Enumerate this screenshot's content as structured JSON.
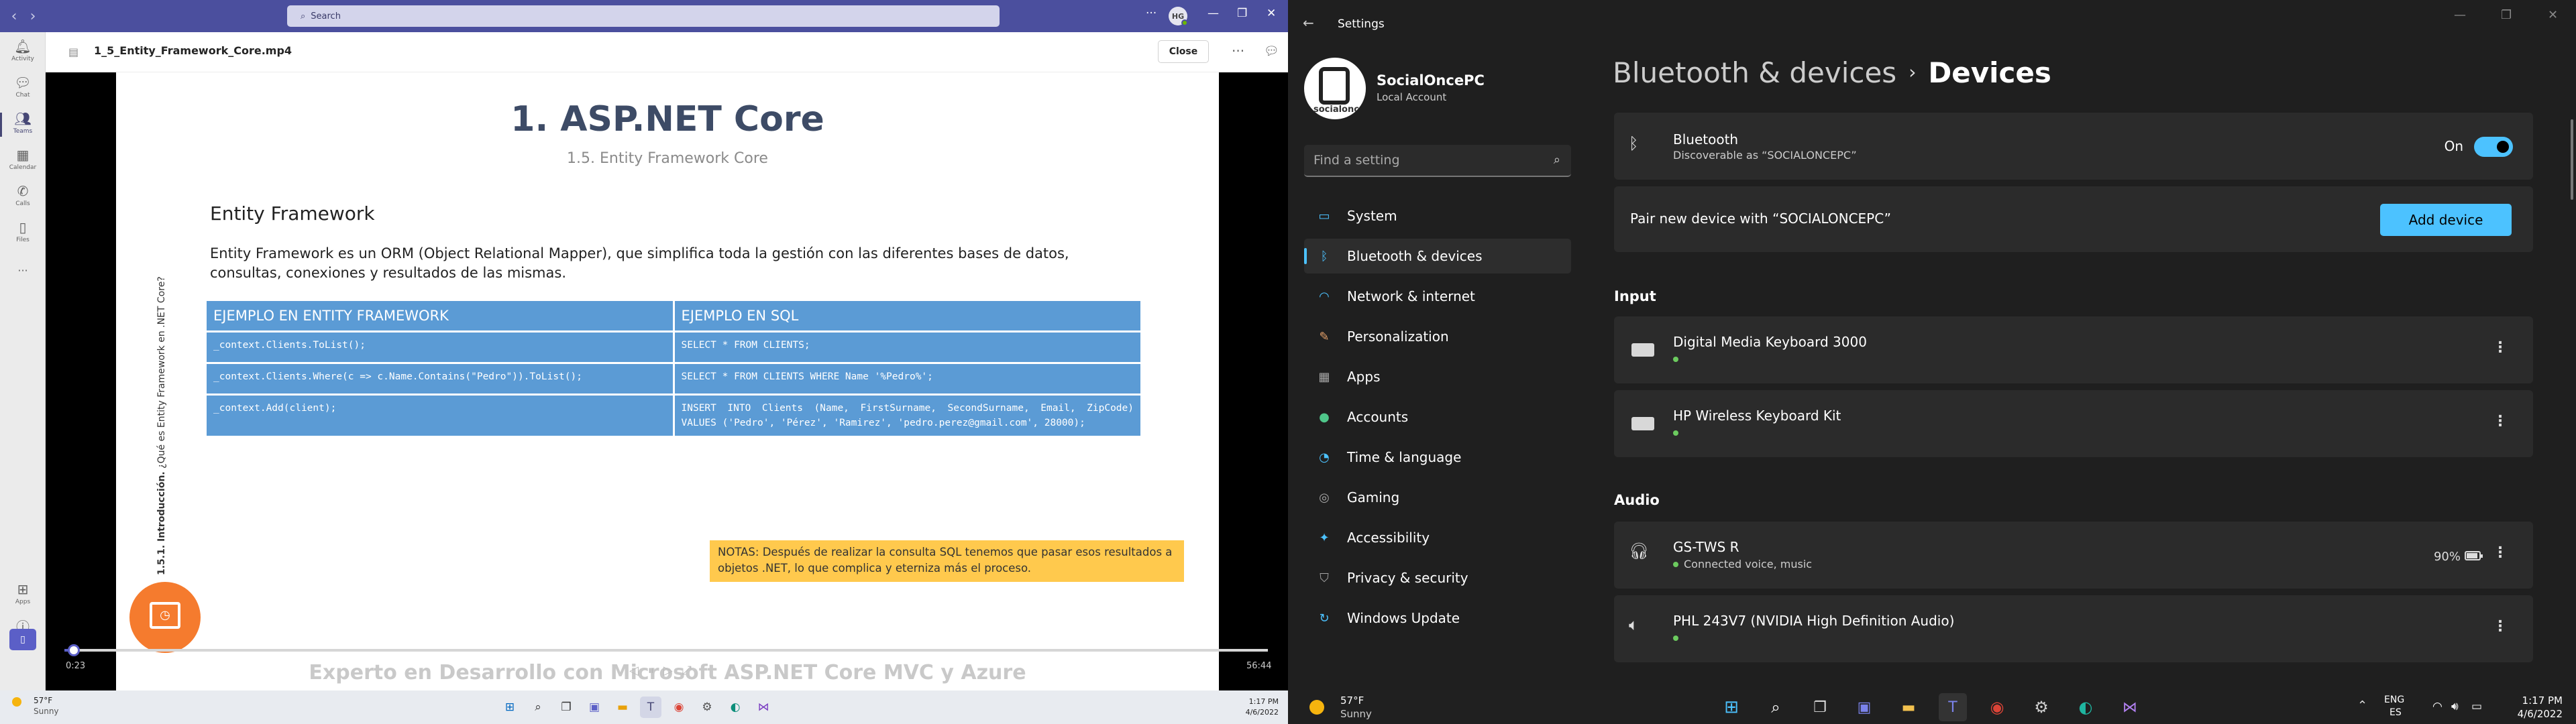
{
  "teams": {
    "search_placeholder": "Search",
    "avatar_initials": "HG",
    "rail": [
      {
        "label": "Activity",
        "icon": "bell-icon"
      },
      {
        "label": "Chat",
        "icon": "chat-icon"
      },
      {
        "label": "Teams",
        "icon": "teams-icon"
      },
      {
        "label": "Calendar",
        "icon": "calendar-icon"
      },
      {
        "label": "Calls",
        "icon": "phone-icon"
      },
      {
        "label": "Files",
        "icon": "file-icon"
      }
    ],
    "rail_more": "···",
    "rail_apps": "Apps",
    "rail_help": "Help",
    "accent": "#4b4f9e"
  },
  "viewer": {
    "file_title": "1_5_Entity_Framework_Core.mp4",
    "close_label": "Close",
    "more": "···",
    "time_current": "0:23",
    "time_duration": "56:44",
    "progress_fraction": 0.007
  },
  "slide": {
    "title": "1. ASP.NET Core",
    "subtitle": "1.5. Entity Framework Core",
    "vertical_bold": "1.5.1. Introducción.",
    "vertical_rest": " ¿Qué es Entity Framework en .NET Core?",
    "heading": "Entity Framework",
    "paragraph": "Entity Framework es un ORM (Object Relational Mapper), que simplifica toda la gestión con las diferentes bases de datos, consultas, conexiones y resultados de las mismas.",
    "table": {
      "headers": [
        "EJEMPLO EN ENTITY FRAMEWORK",
        "EJEMPLO EN SQL"
      ],
      "rows": [
        [
          "_context.Clients.ToList();",
          "SELECT * FROM CLIENTS;"
        ],
        [
          "_context.Clients.Where(c => c.Name.Contains(\"Pedro\")).ToList();",
          "SELECT * FROM CLIENTS WHERE Name '%Pedro%';"
        ],
        [
          "_context.Add(client);",
          "INSERT INTO Clients (Name, FirstSurname, SecondSurname, Email, ZipCode) VALUES ('Pedro', 'Pérez', 'Ramirez', 'pedro.perez@gmail.com', 28000);"
        ]
      ]
    },
    "note": "NOTAS: Después de realizar la consulta SQL tenemos que pasar esos resultados a objetos .NET, lo que complica y eterniza más el proceso.",
    "footer": "Experto en Desarrollo con Microsoft ASP.NET Core MVC y Azure"
  },
  "left_taskbar": {
    "weather_temp": "57°F",
    "weather_cond": "Sunny",
    "time": "1:17 PM",
    "date": "4/6/2022"
  },
  "settings": {
    "app_title": "Settings",
    "user_name": "SocialOncePC",
    "account_type": "Local Account",
    "avatar_text": "socialonce",
    "search_placeholder": "Find a setting",
    "nav": [
      {
        "label": "System",
        "icon": "monitor-icon",
        "color": "#4cc2ff"
      },
      {
        "label": "Bluetooth & devices",
        "icon": "bluetooth-icon",
        "color": "#4cc2ff"
      },
      {
        "label": "Network & internet",
        "icon": "wifi-icon",
        "color": "#4cc2ff"
      },
      {
        "label": "Personalization",
        "icon": "brush-icon",
        "color": "#e8a36b"
      },
      {
        "label": "Apps",
        "icon": "apps-icon",
        "color": "#a6a6a6"
      },
      {
        "label": "Accounts",
        "icon": "person-icon",
        "color": "#4fc68a"
      },
      {
        "label": "Time & language",
        "icon": "globe-clock-icon",
        "color": "#4cc2ff"
      },
      {
        "label": "Gaming",
        "icon": "gamepad-icon",
        "color": "#a6a6a6"
      },
      {
        "label": "Accessibility",
        "icon": "accessibility-icon",
        "color": "#4cc2ff"
      },
      {
        "label": "Privacy & security",
        "icon": "shield-icon",
        "color": "#a6a6a6"
      },
      {
        "label": "Windows Update",
        "icon": "update-icon",
        "color": "#4cc2ff"
      }
    ],
    "selected_index": 1,
    "breadcrumb_parent": "Bluetooth & devices",
    "breadcrumb_current": "Devices",
    "bluetooth": {
      "title": "Bluetooth",
      "subtitle": "Discoverable as “SOCIALONCEPC”",
      "state": "On"
    },
    "pair_text": "Pair new device with “SOCIALONCEPC”",
    "add_device": "Add device",
    "input_header": "Input",
    "input_devices": [
      "Digital Media Keyboard 3000",
      "HP Wireless Keyboard Kit"
    ],
    "audio_header": "Audio",
    "audio": [
      {
        "name": "GS-TWS R",
        "status": "Connected voice, music",
        "battery": "90%"
      },
      {
        "name": "PHL 243V7 (NVIDIA High Definition Audio)",
        "status": ""
      }
    ],
    "accent": "#4cc2ff"
  },
  "right_taskbar": {
    "weather_temp": "57°F",
    "weather_cond": "Sunny",
    "lang": "ENG",
    "lang2": "ES",
    "time": "1:17 PM",
    "date": "4/6/2022"
  }
}
